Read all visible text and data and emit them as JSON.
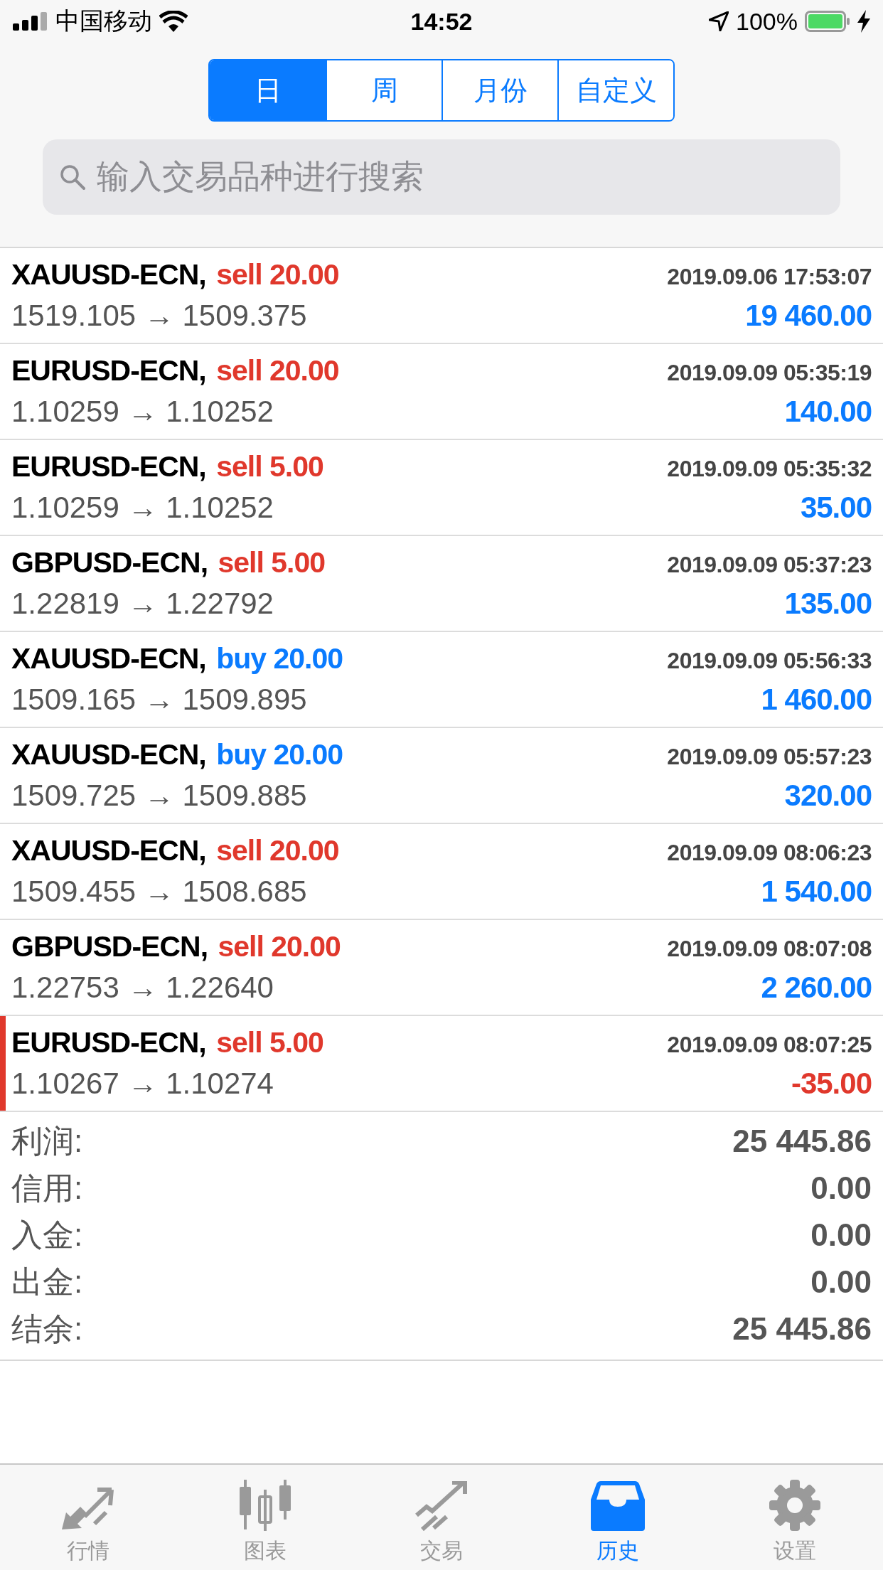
{
  "status_bar": {
    "carrier": "中国移动",
    "time": "14:52",
    "battery": "100%"
  },
  "period_tabs": [
    {
      "label": "日",
      "selected": true
    },
    {
      "label": "周",
      "selected": false
    },
    {
      "label": "月份",
      "selected": false
    },
    {
      "label": "自定义",
      "selected": false
    }
  ],
  "search": {
    "placeholder": "输入交易品种进行搜索"
  },
  "deals": [
    {
      "symbol": "XAUUSD-ECN,",
      "kind": "sell",
      "order": "sell 20.00",
      "time": "2019.09.06 17:53:07",
      "prices": "1519.105 → 1509.375",
      "profit": "19 460.00",
      "loss": false,
      "selected": false
    },
    {
      "symbol": "EURUSD-ECN,",
      "kind": "sell",
      "order": "sell 20.00",
      "time": "2019.09.09 05:35:19",
      "prices": "1.10259 → 1.10252",
      "profit": "140.00",
      "loss": false,
      "selected": false
    },
    {
      "symbol": "EURUSD-ECN,",
      "kind": "sell",
      "order": "sell 5.00",
      "time": "2019.09.09 05:35:32",
      "prices": "1.10259 → 1.10252",
      "profit": "35.00",
      "loss": false,
      "selected": false
    },
    {
      "symbol": "GBPUSD-ECN,",
      "kind": "sell",
      "order": "sell 5.00",
      "time": "2019.09.09 05:37:23",
      "prices": "1.22819 → 1.22792",
      "profit": "135.00",
      "loss": false,
      "selected": false
    },
    {
      "symbol": "XAUUSD-ECN,",
      "kind": "buy",
      "order": "buy 20.00",
      "time": "2019.09.09 05:56:33",
      "prices": "1509.165 → 1509.895",
      "profit": "1 460.00",
      "loss": false,
      "selected": false
    },
    {
      "symbol": "XAUUSD-ECN,",
      "kind": "buy",
      "order": "buy 20.00",
      "time": "2019.09.09 05:57:23",
      "prices": "1509.725 → 1509.885",
      "profit": "320.00",
      "loss": false,
      "selected": false
    },
    {
      "symbol": "XAUUSD-ECN,",
      "kind": "sell",
      "order": "sell 20.00",
      "time": "2019.09.09 08:06:23",
      "prices": "1509.455 → 1508.685",
      "profit": "1 540.00",
      "loss": false,
      "selected": false
    },
    {
      "symbol": "GBPUSD-ECN,",
      "kind": "sell",
      "order": "sell 20.00",
      "time": "2019.09.09 08:07:08",
      "prices": "1.22753 → 1.22640",
      "profit": "2 260.00",
      "loss": false,
      "selected": false
    },
    {
      "symbol": "EURUSD-ECN,",
      "kind": "sell",
      "order": "sell 5.00",
      "time": "2019.09.09 08:07:25",
      "prices": "1.10267 → 1.10274",
      "profit": "-35.00",
      "loss": true,
      "selected": true
    }
  ],
  "summary": [
    {
      "label": "利润:",
      "value": "25 445.86"
    },
    {
      "label": "信用:",
      "value": "0.00"
    },
    {
      "label": "入金:",
      "value": "0.00"
    },
    {
      "label": "出金:",
      "value": "0.00"
    },
    {
      "label": "结余:",
      "value": "25 445.86"
    }
  ],
  "tab_bar": [
    {
      "kind": "quotes",
      "label": "行情",
      "selected": false
    },
    {
      "kind": "chart",
      "label": "图表",
      "selected": false
    },
    {
      "kind": "trade",
      "label": "交易",
      "selected": false
    },
    {
      "kind": "history",
      "label": "历史",
      "selected": true
    },
    {
      "kind": "settings",
      "label": "设置",
      "selected": false
    }
  ]
}
